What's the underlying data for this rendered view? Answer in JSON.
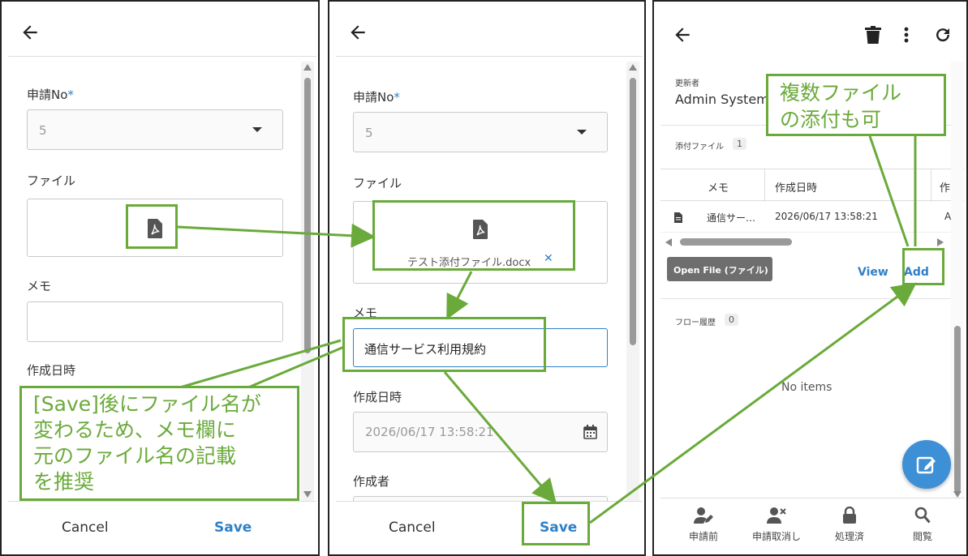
{
  "panel1": {
    "app_no_label": "申請No",
    "required_mark": "*",
    "app_no_value": "5",
    "file_label": "ファイル",
    "memo_label": "メモ",
    "created_label": "作成日時",
    "cancel": "Cancel",
    "save": "Save"
  },
  "panel2": {
    "app_no_label": "申請No",
    "required_mark": "*",
    "app_no_value": "5",
    "file_label": "ファイル",
    "file_name": "テスト添付ファイル.docx",
    "remove_mark": "✕",
    "memo_label": "メモ",
    "memo_value": "通信サービス利用規約",
    "created_label": "作成日時",
    "created_value": "2026/06/17 13:58:21",
    "creator_label": "作成者",
    "cancel": "Cancel",
    "save": "Save"
  },
  "panel3": {
    "updater_label": "更新者",
    "updater_value": "Admin System",
    "attach_label": "添付ファイル",
    "attach_count": "1",
    "col_memo": "メモ",
    "col_created": "作成日時",
    "col_partial": "作",
    "row_memo": "通信サー…",
    "row_created": "2026/06/17 13:58:21",
    "row_partial": "A",
    "tooltip": "Open File (ファイル)",
    "view": "View",
    "add": "Add",
    "flow_label": "フロー履歴",
    "flow_count": "0",
    "no_items": "No items",
    "nav": [
      {
        "label": "申請前",
        "icon": "user-edit-icon"
      },
      {
        "label": "申請取消し",
        "icon": "user-remove-icon"
      },
      {
        "label": "処理済",
        "icon": "lock-icon"
      },
      {
        "label": "閲覧",
        "icon": "search-icon"
      }
    ]
  },
  "annotations": {
    "note_save": "[Save]後にファイル名が変わるため、メモ欄に元のファイル名の記載を推奨",
    "note_save_lines": [
      "[Save]後にファイル名が",
      "変わるため、メモ欄に",
      "元のファイル名の記載",
      "を推奨"
    ],
    "note_multi_lines": [
      "複数ファイル",
      "の添付も可"
    ]
  },
  "colors": {
    "accent": "#2f80c8",
    "annotation": "#6aaa3a",
    "fab": "#3d8fd6"
  }
}
